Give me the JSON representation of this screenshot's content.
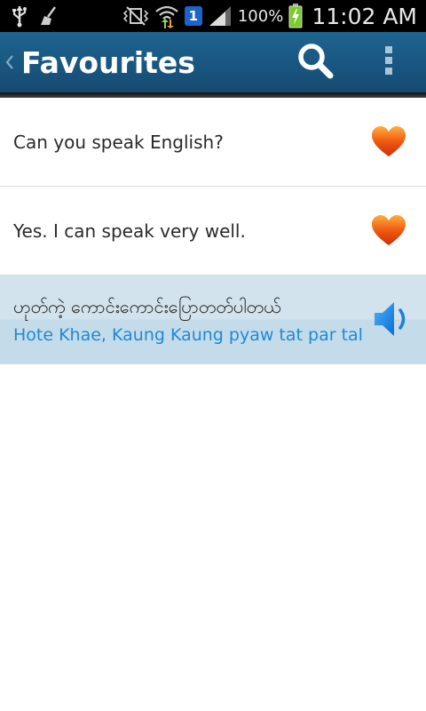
{
  "status_bar": {
    "notification_count": "1",
    "battery_percent": "100%",
    "time": "11:02 AM",
    "icons": [
      "usb-icon",
      "broom-icon",
      "vibrate-mute-icon",
      "wifi-icon",
      "notification-badge-icon",
      "signal-icon",
      "battery-charging-icon"
    ]
  },
  "action_bar": {
    "title": "Favourites",
    "icons": [
      "up-caret-icon",
      "search-icon",
      "overflow-menu-icon"
    ]
  },
  "favourites": [
    {
      "text": "Can you speak English?",
      "icon": "heart-icon"
    },
    {
      "text": "Yes. I can speak very well.",
      "icon": "heart-icon"
    }
  ],
  "selected_translation": {
    "myanmar": "ဟုတ်ကဲ့ ကောင်းကောင်းပြောတတ်ပါတယ်",
    "romanization": "Hote Khae, Kaung Kaung pyaw tat par tal",
    "icon": "speaker-icon"
  },
  "colors": {
    "action_bar": "#1a5a84",
    "selection": "#cde0ec",
    "romanization": "#1e8ad8",
    "heart": "#f05a10"
  }
}
